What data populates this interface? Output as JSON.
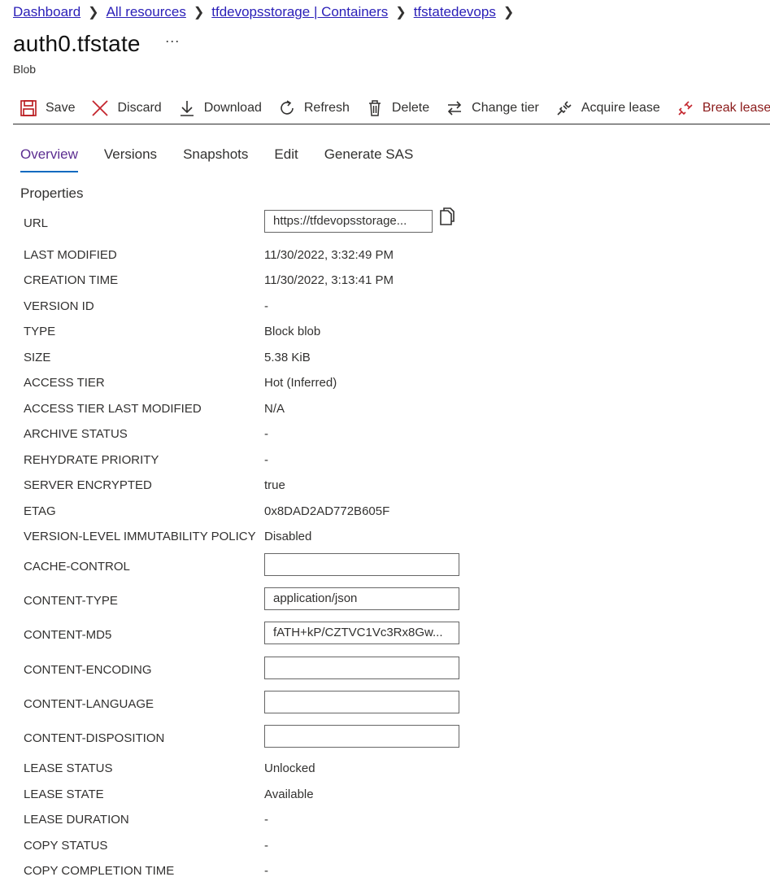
{
  "breadcrumb": {
    "items": [
      "Dashboard",
      "All resources",
      "tfdevopsstorage | Containers",
      "tfstatedevops"
    ]
  },
  "header": {
    "title": "auth0.tfstate",
    "more": "···",
    "subtitle": "Blob"
  },
  "toolbar": {
    "save": "Save",
    "discard": "Discard",
    "download": "Download",
    "refresh": "Refresh",
    "delete": "Delete",
    "change_tier": "Change tier",
    "acquire_lease": "Acquire lease",
    "break_lease": "Break lease"
  },
  "tabs": [
    "Overview",
    "Versions",
    "Snapshots",
    "Edit",
    "Generate SAS"
  ],
  "section_title": "Properties",
  "properties": {
    "url": {
      "label": "URL",
      "value": "https://tfdevopsstorage..."
    },
    "last_modified": {
      "label": "LAST MODIFIED",
      "value": "11/30/2022, 3:32:49 PM"
    },
    "creation_time": {
      "label": "CREATION TIME",
      "value": "11/30/2022, 3:13:41 PM"
    },
    "version_id": {
      "label": "VERSION ID",
      "value": "-"
    },
    "type": {
      "label": "TYPE",
      "value": "Block blob"
    },
    "size": {
      "label": "SIZE",
      "value": "5.38 KiB"
    },
    "access_tier": {
      "label": "ACCESS TIER",
      "value": "Hot (Inferred)"
    },
    "access_tier_last_modified": {
      "label": "ACCESS TIER LAST MODIFIED",
      "value": "N/A"
    },
    "archive_status": {
      "label": "ARCHIVE STATUS",
      "value": "-"
    },
    "rehydrate_priority": {
      "label": "REHYDRATE PRIORITY",
      "value": "-"
    },
    "server_encrypted": {
      "label": "SERVER ENCRYPTED",
      "value": "true"
    },
    "etag": {
      "label": "ETAG",
      "value": "0x8DAD2AD772B605F"
    },
    "immutability": {
      "label": "VERSION-LEVEL IMMUTABILITY POLICY",
      "value": "Disabled"
    },
    "cache_control": {
      "label": "CACHE-CONTROL",
      "value": ""
    },
    "content_type": {
      "label": "CONTENT-TYPE",
      "value": "application/json"
    },
    "content_md5": {
      "label": "CONTENT-MD5",
      "value": "fATH+kP/CZTVC1Vc3Rx8Gw..."
    },
    "content_encoding": {
      "label": "CONTENT-ENCODING",
      "value": ""
    },
    "content_language": {
      "label": "CONTENT-LANGUAGE",
      "value": ""
    },
    "content_disposition": {
      "label": "CONTENT-DISPOSITION",
      "value": ""
    },
    "lease_status": {
      "label": "LEASE STATUS",
      "value": "Unlocked"
    },
    "lease_state": {
      "label": "LEASE STATE",
      "value": "Available"
    },
    "lease_duration": {
      "label": "LEASE DURATION",
      "value": "-"
    },
    "copy_status": {
      "label": "COPY STATUS",
      "value": "-"
    },
    "copy_completion_time": {
      "label": "COPY COMPLETION TIME",
      "value": "-"
    }
  }
}
